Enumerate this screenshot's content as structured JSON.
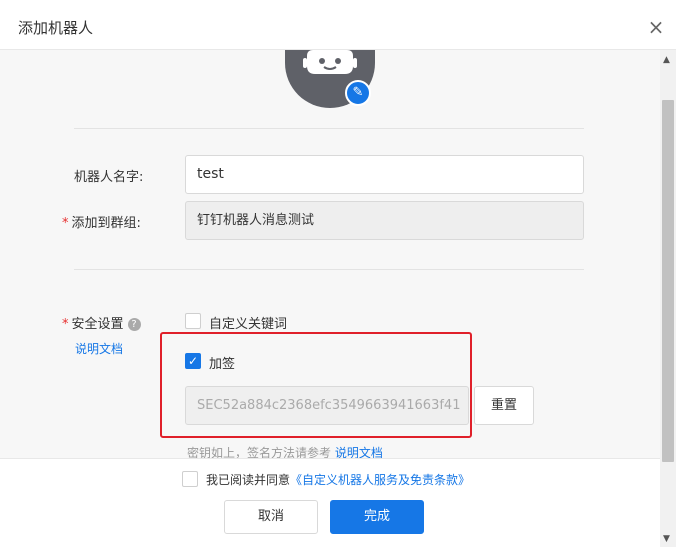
{
  "dialog": {
    "title": "添加机器人",
    "close_glyph": "×"
  },
  "form": {
    "name_label": "机器人名字:",
    "name_value": "test",
    "group_label": "添加到群组:",
    "group_value": "钉钉机器人消息测试",
    "required_mark": "*"
  },
  "security": {
    "label": "安全设置",
    "help_glyph": "?",
    "doc_link": "说明文档",
    "keyword_label": "自定义关键词",
    "sign_label": "加签",
    "sign_checked": true,
    "secret_value": "SEC52a884c2368efc3549663941663f41",
    "reset_label": "重置",
    "hint_text": "密钥如上，签名方法请参考",
    "hint_link": "说明文档"
  },
  "footer": {
    "agree_text": "我已阅读并同意",
    "agree_link": "《自定义机器人服务及免责条款》",
    "cancel_label": "取消",
    "ok_label": "完成"
  },
  "colors": {
    "primary": "#1677e6",
    "highlight": "#e0202a",
    "avatar": "#5f6168"
  },
  "icons": {
    "close": "close-icon",
    "edit": "pencil-icon",
    "help": "question-icon",
    "check": "check-icon"
  }
}
